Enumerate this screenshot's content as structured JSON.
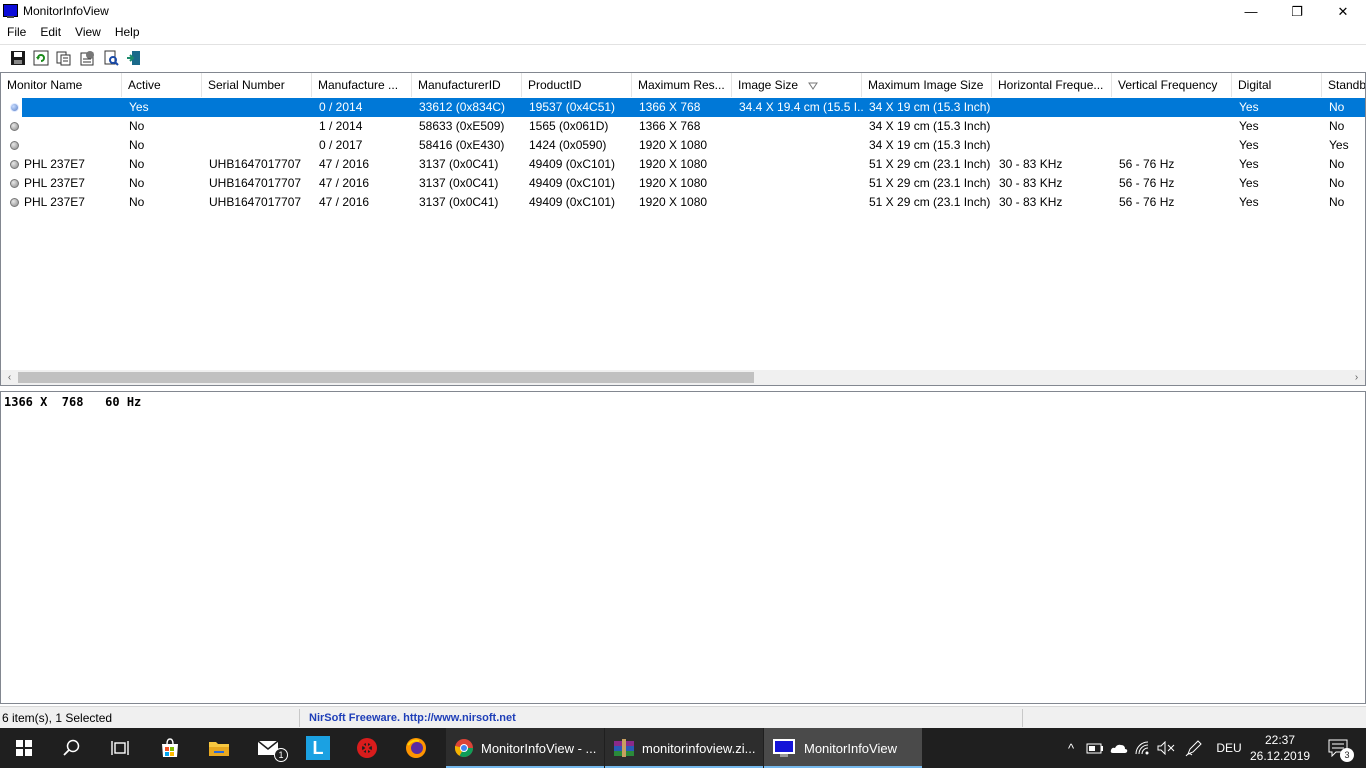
{
  "window": {
    "title": "MonitorInfoView",
    "minimize_glyph": "—",
    "restore_glyph": "❐",
    "close_glyph": "✕"
  },
  "menu": [
    "File",
    "Edit",
    "View",
    "Help"
  ],
  "toolbar": {
    "buttons": [
      "save-icon",
      "refresh-icon",
      "copy-icon",
      "properties-icon",
      "find-icon",
      "exit-icon"
    ]
  },
  "list": {
    "columns": [
      "Monitor Name",
      "Active",
      "Serial Number",
      "Manufacture ...",
      "ManufacturerID",
      "ProductID",
      "Maximum Res...",
      "Image Size",
      "Maximum Image Size",
      "Horizontal Freque...",
      "Vertical Frequency",
      "Digital",
      "Standby"
    ],
    "sorted_column": "Image Size",
    "rows": [
      [
        "",
        "Yes",
        "",
        "0 / 2014",
        "33612 (0x834C)",
        "19537 (0x4C51)",
        "1366 X 768",
        "34.4 X 19.4 cm (15.5 I...",
        "34 X 19 cm (15.3 Inch)",
        "",
        "",
        "Yes",
        "No"
      ],
      [
        "",
        "No",
        "",
        "1 / 2014",
        "58633 (0xE509)",
        "1565 (0x061D)",
        "1366 X 768",
        "",
        "34 X 19 cm (15.3 Inch)",
        "",
        "",
        "Yes",
        "No"
      ],
      [
        "",
        "No",
        "",
        "0 / 2017",
        "58416 (0xE430)",
        "1424 (0x0590)",
        "1920 X 1080",
        "",
        "34 X 19 cm (15.3 Inch)",
        "",
        "",
        "Yes",
        "Yes"
      ],
      [
        "PHL 237E7",
        "No",
        "UHB1647017707",
        "47 / 2016",
        "3137 (0x0C41)",
        "49409 (0xC101)",
        "1920 X 1080",
        "",
        "51 X 29 cm (23.1 Inch)",
        "30 - 83 KHz",
        "56 - 76 Hz",
        "Yes",
        "No"
      ],
      [
        "PHL 237E7",
        "No",
        "UHB1647017707",
        "47 / 2016",
        "3137 (0x0C41)",
        "49409 (0xC101)",
        "1920 X 1080",
        "",
        "51 X 29 cm (23.1 Inch)",
        "30 - 83 KHz",
        "56 - 76 Hz",
        "Yes",
        "No"
      ],
      [
        "PHL 237E7",
        "No",
        "UHB1647017707",
        "47 / 2016",
        "3137 (0x0C41)",
        "49409 (0xC101)",
        "1920 X 1080",
        "",
        "51 X 29 cm (23.1 Inch)",
        "30 - 83 KHz",
        "56 - 76 Hz",
        "Yes",
        "No"
      ]
    ],
    "selected_row": 0,
    "scroll_left_glyph": "‹",
    "scroll_right_glyph": "›"
  },
  "lower_pane": {
    "text": "1366 X  768   60 Hz"
  },
  "status": {
    "items": "6 item(s), 1 Selected",
    "credit": "NirSoft Freeware.  http://www.nirsoft.net"
  },
  "taskbar": {
    "start_icon": "windows-start-icon",
    "pinned": [
      "search-icon",
      "task-view-icon",
      "store-icon",
      "file-explorer-icon",
      "mail-icon",
      "l-app-icon",
      "yandex-icon",
      "firefox-icon"
    ],
    "mail_badge": "1",
    "l_app_letter": "L",
    "apps": [
      {
        "label": "MonitorInfoView - ...",
        "icon": "chrome-icon"
      },
      {
        "label": "monitorinfoview.zi...",
        "icon": "winrar-icon"
      },
      {
        "label": "MonitorInfoView",
        "icon": "monitorinfoview-icon"
      }
    ],
    "tray_chevron": "^",
    "language": "DEU",
    "time": "22:37",
    "date": "26.12.2019",
    "notification_count": "3"
  },
  "colors": {
    "selection": "#0078d7",
    "taskbar": "#1f1f1f",
    "credit_text": "#1f3fb8"
  }
}
